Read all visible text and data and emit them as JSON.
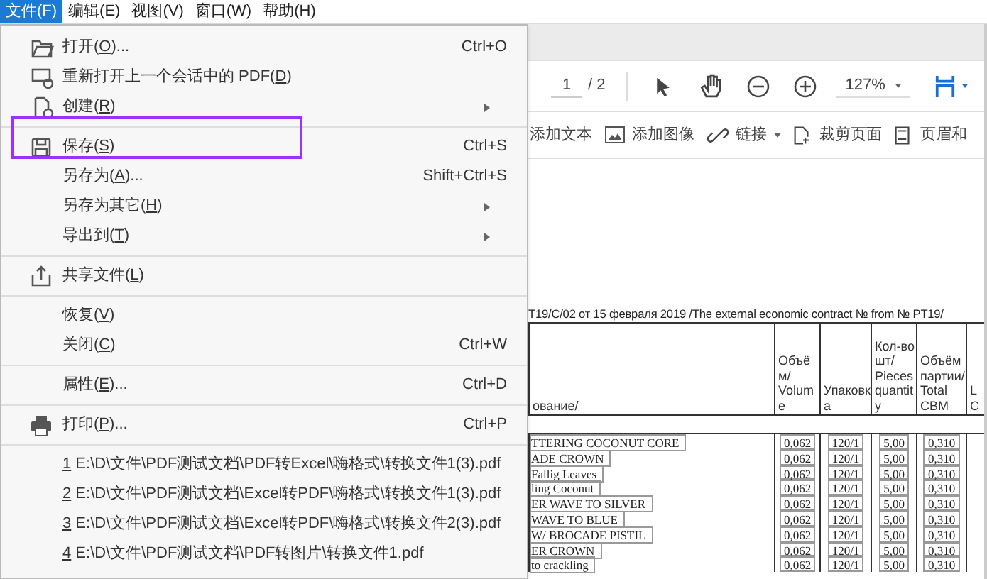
{
  "menu_bar": [
    {
      "label": "文件(F)",
      "selected": true
    },
    {
      "label": "编辑(E)",
      "selected": false
    },
    {
      "label": "视图(V)",
      "selected": false
    },
    {
      "label": "窗口(W)",
      "selected": false
    },
    {
      "label": "帮助(H)",
      "selected": false
    }
  ],
  "file_menu": {
    "groups": [
      [
        {
          "before": "打开(",
          "key": "O",
          "after": ")...",
          "shortcut": "Ctrl+O",
          "submenu": false
        },
        {
          "before": "重新打开上一个会话中的 PDF(",
          "key": "D",
          "after": ")",
          "submenu": false
        },
        {
          "before": "创建(",
          "key": "R",
          "after": ")",
          "submenu": true
        }
      ],
      [
        {
          "before": "保存(",
          "key": "S",
          "after": ")",
          "shortcut": "Ctrl+S",
          "submenu": false
        },
        {
          "before": "另存为(",
          "key": "A",
          "after": ")...",
          "shortcut": "Shift+Ctrl+S",
          "submenu": false
        },
        {
          "before": "另存为其它(",
          "key": "H",
          "after": ")",
          "submenu": true
        },
        {
          "before": "导出到(",
          "key": "T",
          "after": ")",
          "submenu": true
        }
      ],
      [
        {
          "before": "共享文件(",
          "key": "L",
          "after": ")",
          "submenu": false
        }
      ],
      [
        {
          "before": "恢复(",
          "key": "V",
          "after": ")",
          "submenu": false
        },
        {
          "before": "关闭(",
          "key": "C",
          "after": ")",
          "shortcut": "Ctrl+W",
          "submenu": false
        }
      ],
      [
        {
          "before": "属性(",
          "key": "E",
          "after": ")...",
          "shortcut": "Ctrl+D",
          "submenu": false
        }
      ],
      [
        {
          "before": "打印(",
          "key": "P",
          "after": ")...",
          "shortcut": "Ctrl+P",
          "submenu": false
        }
      ],
      [
        {
          "key": "1",
          "after": " E:\\D\\文件\\PDF测试文档\\PDF转Excel\\嗨格式\\转换文件1(3).pdf",
          "submenu": false
        },
        {
          "key": "2",
          "after": " E:\\D\\文件\\PDF测试文档\\Excel转PDF\\嗨格式\\转换文件1(3).pdf",
          "submenu": false
        },
        {
          "key": "3",
          "after": " E:\\D\\文件\\PDF测试文档\\Excel转PDF\\嗨格式\\转换文件2(3).pdf",
          "submenu": false
        },
        {
          "key": "4",
          "after": " E:\\D\\文件\\PDF测试文档\\PDF转图片\\转换文件1.pdf",
          "submenu": false
        }
      ]
    ]
  },
  "page_nav": {
    "current": "1",
    "total": "/ 2"
  },
  "zoom": "127%",
  "tools": [
    {
      "label": "添加文本",
      "dropdown": false
    },
    {
      "label": "添加图像",
      "dropdown": false
    },
    {
      "label": "链接",
      "dropdown": true
    },
    {
      "label": "裁剪页面",
      "dropdown": false
    },
    {
      "label": "页眉和",
      "dropdown": false
    }
  ],
  "document": {
    "title": "T19/C/02  от 15 февраля 2019 /The external economic contract №  from № PT19/",
    "columns": [
      {
        "lines": [
          "ование/"
        ]
      },
      {
        "lines": [
          "Объё",
          "м/",
          "Volum",
          "e"
        ]
      },
      {
        "lines": [
          "Упаковк",
          "а"
        ]
      },
      {
        "lines": [
          "Кол-во",
          "шт/",
          "Pieces",
          "quantit",
          "y"
        ]
      },
      {
        "lines": [
          "Объём",
          "партии/",
          "Total",
          "CBM"
        ]
      },
      {
        "lines": [
          "L",
          "C"
        ]
      }
    ],
    "rows": [
      {
        "cells": [
          "TTERING  COCONUT   CORE",
          "0,062",
          "120/1",
          "5,00",
          "0,310"
        ]
      },
      {
        "cells": [
          "ADE CROWN",
          "0,062",
          "120/1",
          "5,00",
          "0,310"
        ]
      },
      {
        "cells": [
          "Fallig Leaves",
          "0,062",
          "120/1",
          "5,00",
          "0,310"
        ]
      },
      {
        "cells": [
          "ling Coconut",
          "0,062",
          "120/1",
          "5,00",
          "0,310"
        ]
      },
      {
        "cells": [
          "ER WAVE TO SILVER",
          "0,062",
          "120/1",
          "5,00",
          "0,310"
        ]
      },
      {
        "cells": [
          "WAVE TO BLUE",
          "0,062",
          "120/1",
          "5,00",
          "0,310"
        ]
      },
      {
        "cells": [
          "W/ BROCADE  PISTIL",
          "0,062",
          "120/1",
          "5,00",
          "0,310"
        ]
      },
      {
        "cells": [
          "ER CROWN",
          "0,062",
          "120/1",
          "5,00",
          "0,310"
        ]
      },
      {
        "cells": [
          "to crackling",
          "0,062",
          "120/1",
          "5,00",
          "0,310"
        ]
      }
    ]
  }
}
